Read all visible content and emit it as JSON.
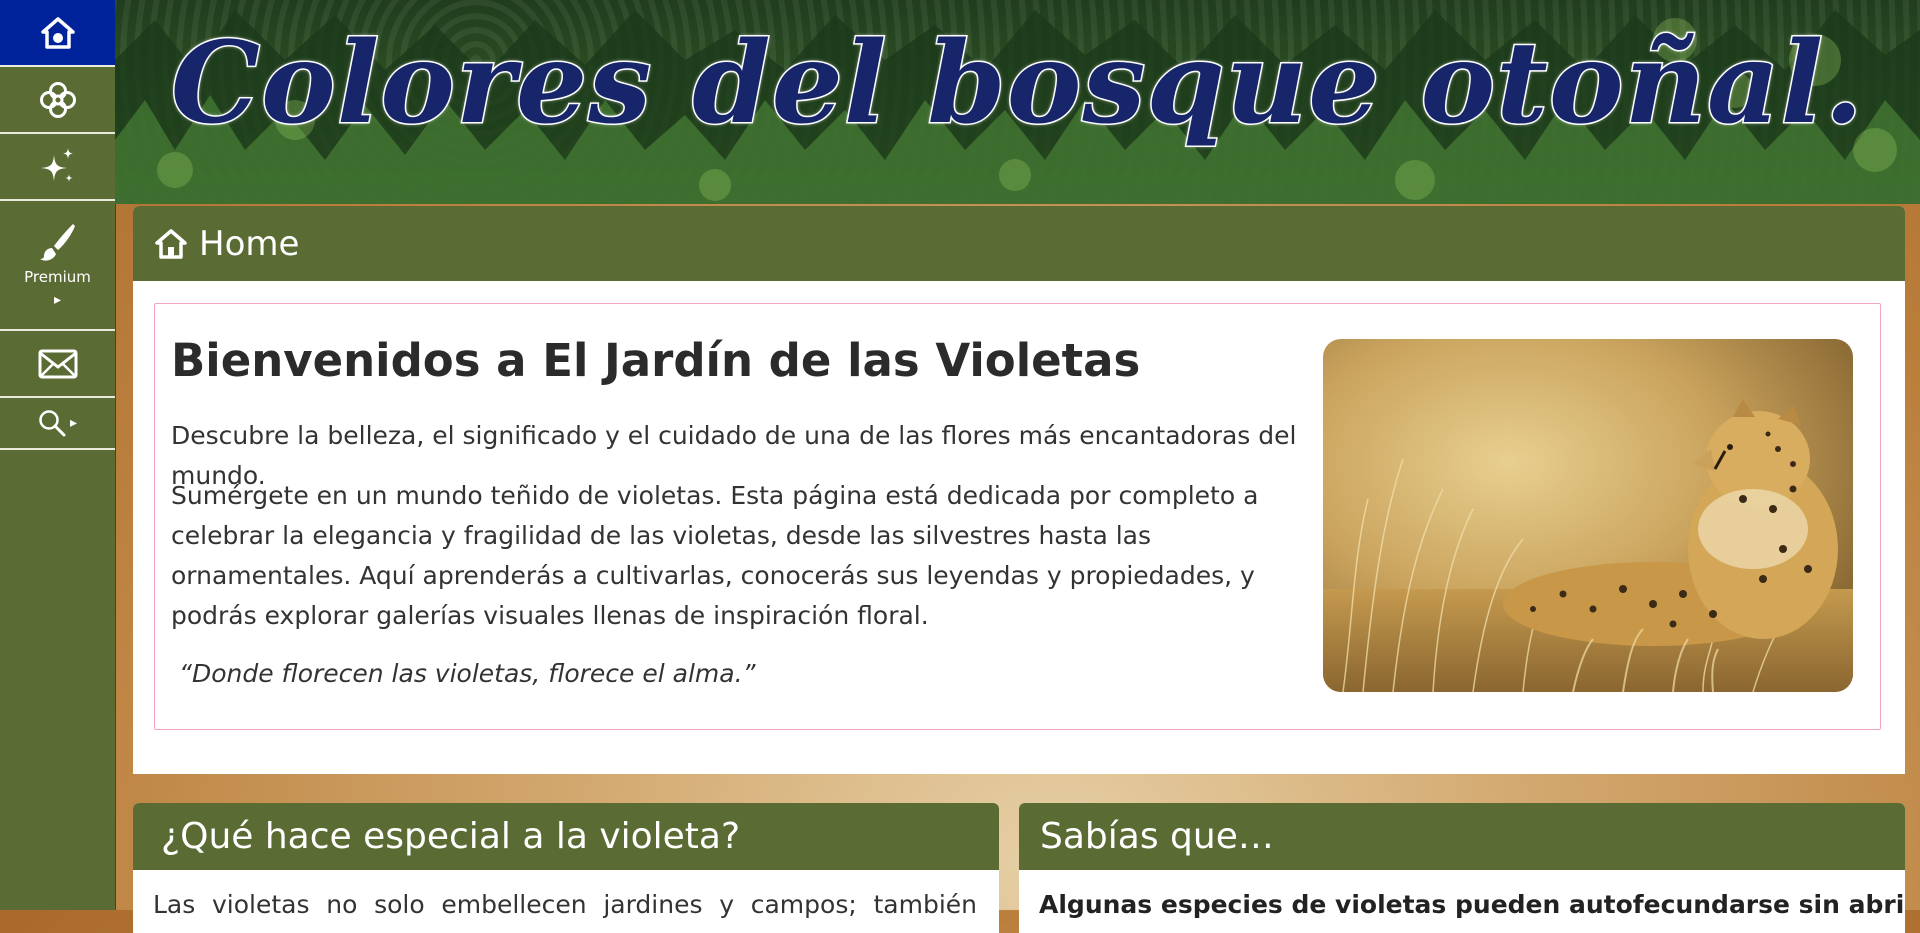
{
  "sidebar": {
    "items": [
      {
        "icon": "home-icon",
        "label": ""
      },
      {
        "icon": "flower-icon",
        "label": ""
      },
      {
        "icon": "sparkle-icon",
        "label": ""
      },
      {
        "icon": "brush-icon",
        "label": "Premium",
        "caret": "▸"
      },
      {
        "icon": "mail-icon",
        "label": ""
      },
      {
        "icon": "search-icon",
        "label": "",
        "caret": "▸"
      }
    ],
    "active_color": "#00239c",
    "background": "#5b6b34"
  },
  "banner": {
    "title": "Colores del bosque otoñal."
  },
  "home_panel": {
    "header": "Home",
    "welcome_title": "Bienvenidos a El Jardín de las Violetas",
    "intro": "Descubre la belleza, el significado y el cuidado de una de las flores más encantadoras del mundo.",
    "body": "Sumérgete en un mundo teñido de violetas. Esta página está dedicada por completo a celebrar la elegancia y fragilidad de las violetas, desde las silvestres hasta las ornamentales. Aquí aprenderás a cultivarlas, conocerás sus leyendas y propiedades, y podrás explorar galerías visuales llenas de inspiración floral.",
    "quote": "“Donde florecen las violetas, florece el alma.”",
    "image": "cheetah-photo"
  },
  "cards": [
    {
      "title": "¿Qué hace especial a la violeta?",
      "text": "Las violetas no solo embellecen jardines y campos; también"
    },
    {
      "title": "Sabías que…",
      "text": "Algunas especies de violetas pueden autofecundarse sin abrir sus"
    }
  ],
  "colors": {
    "header_green": "#5b6b34",
    "title_blue": "#17266b",
    "card_border_pink": "#f2a6c4"
  }
}
